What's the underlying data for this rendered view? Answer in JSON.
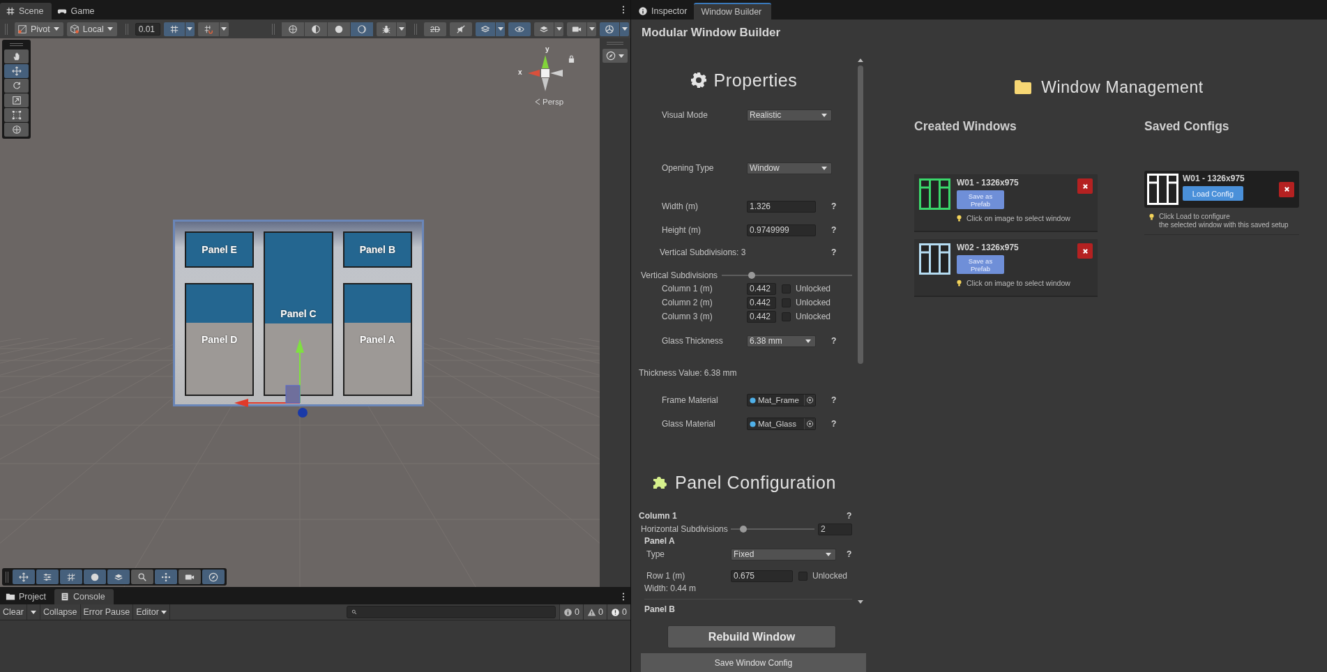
{
  "scene_tabs": [
    {
      "label": "Scene",
      "kind": "hash",
      "selected": true
    },
    {
      "label": "Game",
      "kind": "gamepad",
      "selected": false
    }
  ],
  "scene_toolbar": {
    "pivot": "Pivot",
    "space": "Local",
    "snap_value": "0.01",
    "snap_buttons": [
      {
        "kind": "gridsnap",
        "selected": true
      },
      {
        "kind": "gridmagnet",
        "selected": false
      }
    ],
    "shading": [
      {
        "kind": "wireglobe",
        "selected": false
      },
      {
        "kind": "halfglobe",
        "selected": false
      },
      {
        "kind": "sphere",
        "selected": false
      },
      {
        "kind": "moon",
        "selected": true
      }
    ],
    "toggles": [
      {
        "kind": "bug",
        "selected": false,
        "dropdown": true
      },
      {
        "kind": "twod",
        "label": "2D",
        "selected": false,
        "dropdown": false
      },
      {
        "kind": "audio",
        "selected": false,
        "dropdown": false
      },
      {
        "kind": "effects",
        "selected": true,
        "dropdown": true
      },
      {
        "kind": "eye",
        "selected": true,
        "dropdown": false
      },
      {
        "kind": "layers",
        "selected": false,
        "dropdown": true
      },
      {
        "kind": "camera",
        "selected": false,
        "dropdown": true
      },
      {
        "kind": "gizmo",
        "selected": true,
        "dropdown": true
      }
    ]
  },
  "tools": [
    {
      "kind": "hand",
      "selected": false
    },
    {
      "kind": "move",
      "selected": true
    },
    {
      "kind": "rotate",
      "selected": false
    },
    {
      "kind": "scale",
      "selected": false
    },
    {
      "kind": "rect",
      "selected": false
    },
    {
      "kind": "transform",
      "selected": false
    }
  ],
  "orientation": {
    "x_label": "x",
    "y_label": "y",
    "projection": "Persp"
  },
  "model": {
    "columns": [
      {
        "panels": [
          {
            "label": "Panel E",
            "kind": "sash"
          },
          {
            "label": "Panel D",
            "kind": "tall"
          }
        ]
      },
      {
        "panels": [
          {
            "label": "Panel C",
            "kind": "full"
          }
        ]
      },
      {
        "panels": [
          {
            "label": "Panel B",
            "kind": "sash"
          },
          {
            "label": "Panel A",
            "kind": "tall"
          }
        ]
      }
    ]
  },
  "overlay_tools": [
    {
      "kind": "move",
      "selected": true
    },
    {
      "kind": "sliders",
      "selected": true
    },
    {
      "kind": "grid",
      "selected": true
    },
    {
      "kind": "sphere",
      "selected": true
    },
    {
      "kind": "layers",
      "selected": true
    },
    {
      "kind": "search",
      "selected": false
    },
    {
      "kind": "nodes",
      "selected": true
    },
    {
      "kind": "camera",
      "selected": false
    },
    {
      "kind": "compass",
      "selected": true
    }
  ],
  "bottom_tabs": [
    {
      "label": "Project",
      "kind": "folder",
      "selected": false
    },
    {
      "label": "Console",
      "kind": "list",
      "selected": true
    }
  ],
  "console_toolbar": {
    "clear": "Clear",
    "collapse": "Collapse",
    "error_pause": "Error Pause",
    "editor": "Editor",
    "counts": [
      {
        "kind": "info",
        "count": "0"
      },
      {
        "kind": "warning",
        "count": "0"
      },
      {
        "kind": "error",
        "count": "0"
      }
    ]
  },
  "inspector_tabs": [
    {
      "label": "Inspector",
      "kind": "info",
      "selected": false
    },
    {
      "label": "Window Builder",
      "selected": true
    }
  ],
  "title": "Modular Window Builder",
  "properties": {
    "heading": "Properties",
    "rows": [
      {
        "kind": "dropdown",
        "label": "Visual Mode",
        "value": "Realistic"
      },
      {
        "kind": "dropdown",
        "label": "Opening Type",
        "value": "Window"
      },
      {
        "kind": "number",
        "label": "Width (m)",
        "value": "1.326",
        "help": "?"
      },
      {
        "kind": "number",
        "label": "Height (m)",
        "value": "0.9749999",
        "help": "?"
      },
      {
        "kind": "info",
        "label": "Vertical Subdivisions: 3",
        "help": "?"
      },
      {
        "kind": "slider",
        "label": "Vertical Subdivisions",
        "level": 0.23
      },
      {
        "kind": "column",
        "label": "Column 1 (m)",
        "value": "0.442",
        "lock_label": "Unlocked",
        "checked": false
      },
      {
        "kind": "column",
        "label": "Column 2 (m)",
        "value": "0.442",
        "lock_label": "Unlocked",
        "checked": false
      },
      {
        "kind": "column",
        "label": "Column 3 (m)",
        "value": "0.442",
        "lock_label": "Unlocked",
        "checked": false
      },
      {
        "kind": "dropdown",
        "label": "Glass Thickness",
        "value": "6.38 mm",
        "help": "?"
      },
      {
        "kind": "note",
        "label": "Thickness Value: 6.38 mm"
      },
      {
        "kind": "object",
        "label": "Frame Material",
        "value": "Mat_Frame",
        "help": "?"
      },
      {
        "kind": "object",
        "label": "Glass Material",
        "value": "Mat_Glass",
        "help": "?"
      }
    ]
  },
  "panel_config": {
    "heading": "Panel Configuration",
    "column": {
      "label": "Column 1",
      "help": "?",
      "slider_label": "Horizontal Subdivisions",
      "level": 0.15,
      "value": "2",
      "panels": [
        {
          "label": "Panel A",
          "type_label": "Type",
          "type": "Fixed",
          "help": "?",
          "row_label": "Row 1 (m)",
          "row_value": "0.675",
          "lock_label": "Unlocked",
          "checked": false,
          "width": "Width: 0.44 m"
        },
        {
          "label": "Panel B"
        }
      ]
    }
  },
  "actions": [
    {
      "label": "Rebuild Window",
      "kind": "primary"
    },
    {
      "label": "Save Window Config",
      "kind": "secondary"
    }
  ],
  "management": {
    "heading": "Window Management",
    "created": {
      "heading": "Created Windows",
      "items": [
        {
          "name": "W01 - 1326x975",
          "button": "Save as Prefab",
          "hint": "Click on image to select window",
          "color": "#3ad66a"
        },
        {
          "name": "W02 - 1326x975",
          "button": "Save as Prefab",
          "hint": "Click on image to select window",
          "color": "#b5dcf2"
        }
      ]
    },
    "saved": {
      "heading": "Saved Configs",
      "items": [
        {
          "name": "W01 - 1326x975",
          "button": "Load Config",
          "hint": "Click Load to configure\nthe selected window with this saved setup",
          "color": "#ffffff"
        }
      ]
    }
  }
}
